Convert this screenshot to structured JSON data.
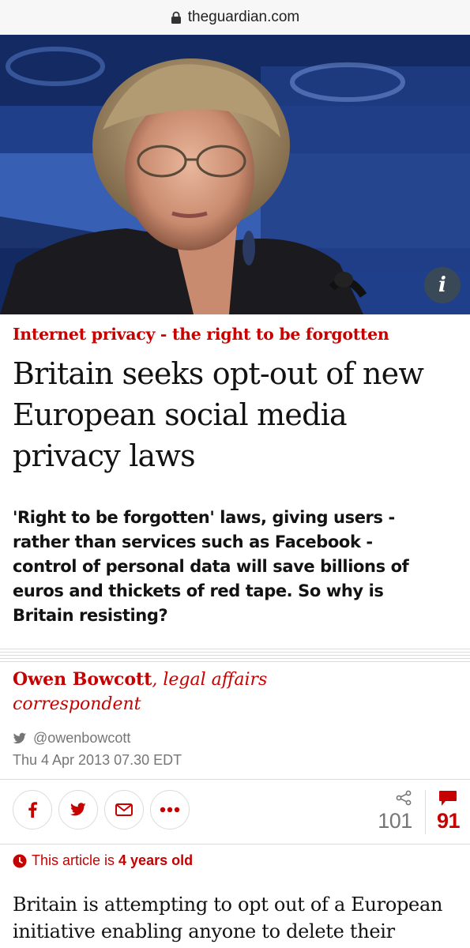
{
  "browser": {
    "url": "theguardian.com"
  },
  "hero": {
    "info_label": "i"
  },
  "article": {
    "kicker": "Internet privacy - the right to be forgotten",
    "headline": "Britain seeks opt-out of new European social media privacy laws",
    "standfirst": "'Right to be forgotten' laws, giving users - rather than services such as Facebook - control of personal data will save billions of euros and thickets of red tape. So why is Britain resisting?",
    "author_name": "Owen Bowcott",
    "author_role": ", legal affairs correspondent",
    "twitter_handle": "@owenbowcott",
    "date": "Thu 4 Apr 2013 07.30 EDT",
    "age_prefix": "This article is",
    "age_value": "4 years old",
    "body_start": "Britain is attempting to opt out of a European initiative enabling anyone to delete their"
  },
  "social": {
    "share_count": "101",
    "comment_count": "91",
    "buttons": [
      "facebook-icon",
      "twitter-icon",
      "email-icon",
      "more-icon"
    ]
  },
  "colors": {
    "accent_red": "#c70000",
    "muted": "#767676",
    "rule": "#dcdcdc"
  }
}
